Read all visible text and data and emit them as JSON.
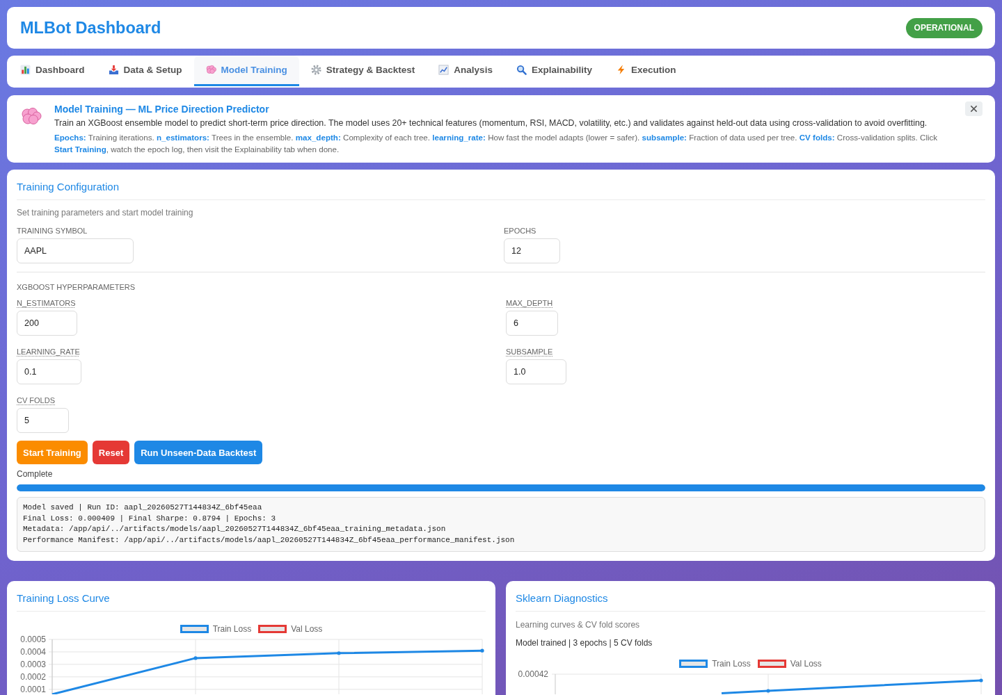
{
  "header": {
    "title": "MLBot Dashboard",
    "status": "OPERATIONAL"
  },
  "tabs": [
    {
      "label": "Dashboard",
      "selected": false
    },
    {
      "label": "Data & Setup",
      "selected": false
    },
    {
      "label": "Model Training",
      "selected": true
    },
    {
      "label": "Strategy & Backtest",
      "selected": false
    },
    {
      "label": "Analysis",
      "selected": false
    },
    {
      "label": "Explainability",
      "selected": false
    },
    {
      "label": "Execution",
      "selected": false
    }
  ],
  "banner": {
    "title": "Model Training — ML Price Direction Predictor",
    "description": "Train an XGBoost ensemble model to predict short-term price direction. The model uses 20+ technical features (momentum, RSI, MACD, volatility, etc.) and validates against held-out data using cross-validation to avoid overfitting.",
    "help": "**Epochs:** Training iterations. **n_estimators:** Trees in the ensemble. **max_depth:** Complexity of each tree. **learning_rate:** How fast the model adapts (lower = safer). **subsample:** Fraction of data used per tree. **CV folds:** Cross-validation splits. Click **Start Training**, watch the epoch log, then visit the Explainability tab when done."
  },
  "training_config": {
    "title": "Training Configuration",
    "subtitle": "Set training parameters and start model training",
    "fields": [
      {
        "label": "TRAINING SYMBOL",
        "value": "AAPL",
        "tooltip": false
      },
      {
        "label": "EPOCHS",
        "value": "12",
        "tooltip": false
      }
    ],
    "hyperparameters": {
      "heading": "XGBOOST HYPERPARAMETERS",
      "fields": [
        {
          "label": "N_ESTIMATORS",
          "value": "200",
          "tooltip": true
        },
        {
          "label": "MAX_DEPTH",
          "value": "6",
          "tooltip": true
        },
        {
          "label": "LEARNING_RATE",
          "value": "0.1",
          "tooltip": true
        },
        {
          "label": "SUBSAMPLE",
          "value": "1.0",
          "tooltip": true
        },
        {
          "label": "CV FOLDS",
          "value": "5",
          "tooltip": true
        }
      ]
    },
    "buttons": [
      {
        "label": "Start Training",
        "kind": "start"
      },
      {
        "label": "Reset",
        "kind": "reset"
      },
      {
        "label": "Run Unseen-Data Backtest",
        "kind": "backtest"
      }
    ],
    "progress": {
      "status": "Complete",
      "level": 1
    },
    "log": [
      "Model saved | Run ID: aapl_20260527T144834Z_6bf45eaa",
      "Final Loss: 0.000409 | Final Sharpe: 0.8794 | Epochs: 3",
      "Metadata: /app/api/../artifacts/models/aapl_20260527T144834Z_6bf45eaa_training_metadata.json",
      "Performance Manifest: /app/api/../artifacts/models/aapl_20260527T144834Z_6bf45eaa_performance_manifest.json"
    ]
  },
  "loss_chart": {
    "title": "Training Loss Curve",
    "chart_data": {
      "type": "line",
      "series": [
        {
          "name": "Train Loss",
          "color": "#1e88e5",
          "values": [
            6e-05,
            0.00035,
            0.00039,
            0.00041
          ]
        },
        {
          "name": "Val Loss",
          "color": "#e53935",
          "values": [
            null,
            null,
            null,
            null
          ]
        }
      ],
      "ylim": [
        6e-05,
        0.0005
      ],
      "yticks": [
        0.0001,
        0.0002,
        0.0003,
        0.0004,
        0.0005
      ],
      "grid": true
    }
  },
  "diagnostics": {
    "title": "Sklearn Diagnostics",
    "subtitle": "Learning curves & CV fold scores",
    "summary": "Model trained | 3 epochs | 5 CV folds",
    "legend": [
      {
        "name": "Train Loss",
        "color": "#1e88e5"
      },
      {
        "name": "Val Loss",
        "color": "#e53935"
      }
    ],
    "y_tick": "0.00042"
  }
}
